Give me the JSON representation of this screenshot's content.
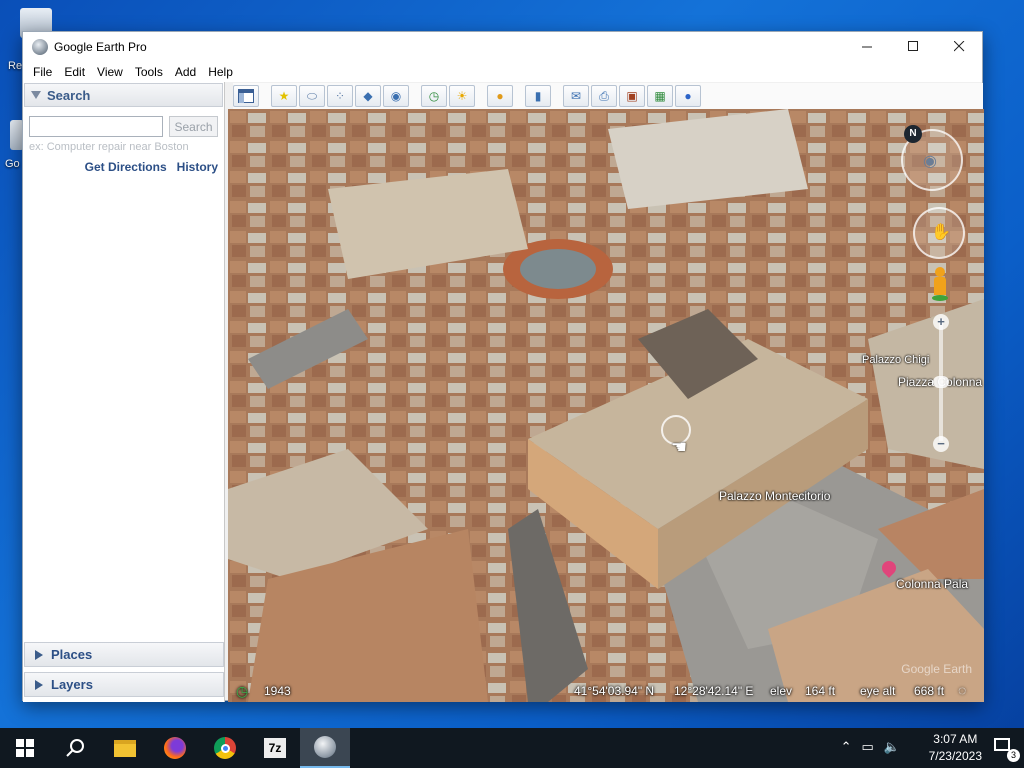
{
  "window": {
    "title": "Google Earth Pro"
  },
  "menu": [
    "File",
    "Edit",
    "View",
    "Tools",
    "Add",
    "Help"
  ],
  "search": {
    "header": "Search",
    "placeholder": "",
    "button": "Search",
    "hint": "ex: Computer repair near Boston",
    "get_directions": "Get Directions",
    "history": "History"
  },
  "sections": {
    "places": "Places",
    "layers": "Layers"
  },
  "map": {
    "labels": {
      "palazzo_montecitorio": "Palazzo Montecitorio",
      "piazza_colonna": "Piazza Colonna",
      "palazzo_chigi": "Palazzo Chigi",
      "colonna_pala": "Colonna Pala"
    },
    "watermark": "Google Earth",
    "compass": "N"
  },
  "status": {
    "year": "1943",
    "lat": "41°54'03.94\" N",
    "lon": "12°28'42.14\" E",
    "elev_label": "elev",
    "elev": "164 ft",
    "eye_label": "eye alt",
    "eye": "668 ft"
  },
  "taskbar": {
    "time": "3:07 AM",
    "date": "7/23/2023",
    "notif_count": "3",
    "app_7z": "7z"
  },
  "desktop": {
    "icon1": "Re",
    "icon2": "Go"
  },
  "colors": {
    "link": "#2c4f86",
    "taskbar": "#101820",
    "desktop": "#1472d8"
  }
}
